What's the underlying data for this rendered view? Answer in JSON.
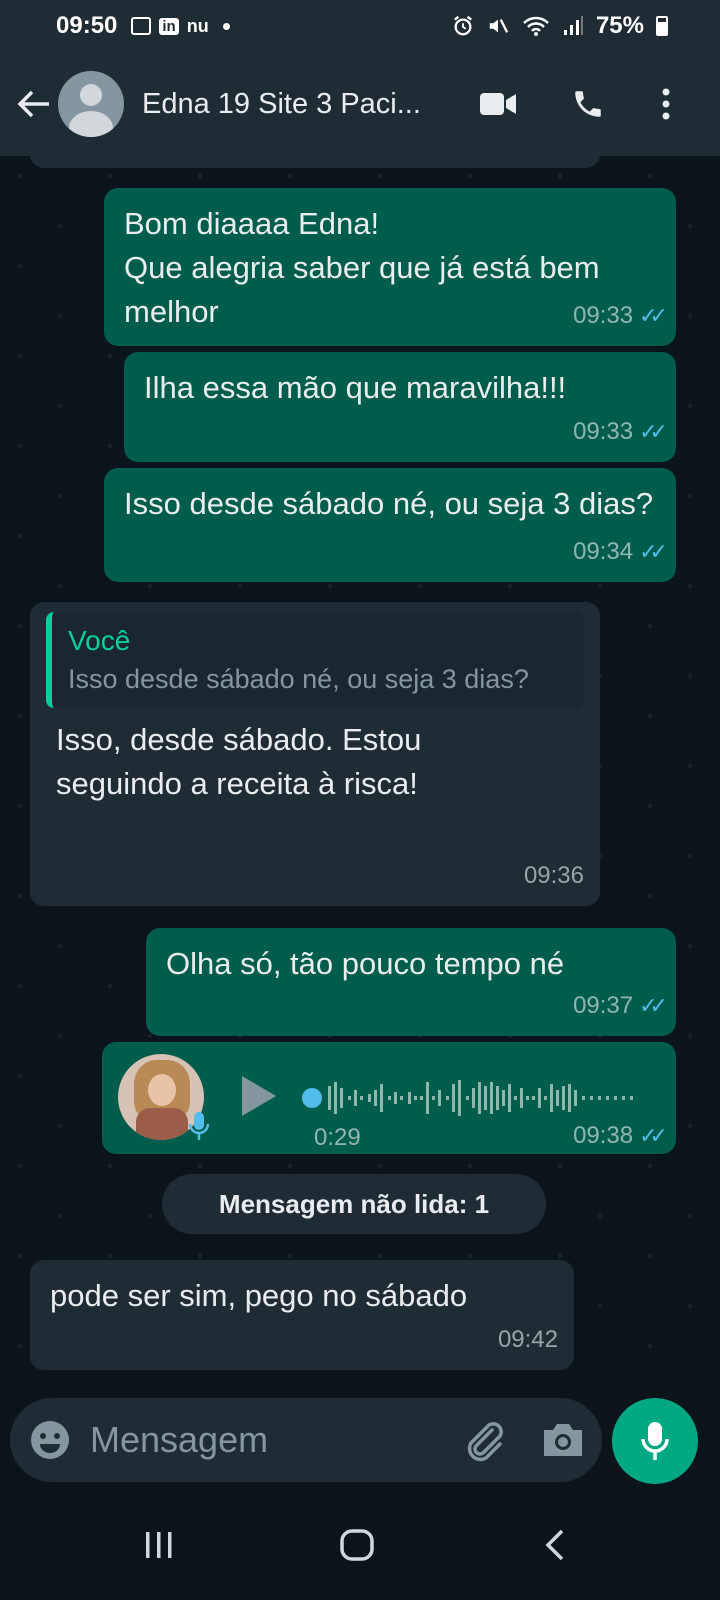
{
  "status_bar": {
    "time": "09:50",
    "left_icons": [
      "gallery-icon",
      "linkedin-icon",
      "nubank-icon",
      "notification-dot"
    ],
    "linkedin_text": "in",
    "nu_text": "nu",
    "right_icons": [
      "alarm-icon",
      "mute-icon",
      "wifi-icon",
      "signal-icon",
      "battery-icon"
    ],
    "battery": "75%"
  },
  "header": {
    "contact_name": "Edna 19 Site 3 Paci...",
    "icons": [
      "back-arrow-icon",
      "video-call-icon",
      "phone-icon",
      "more-options-icon"
    ]
  },
  "messages": [
    {
      "type": "out",
      "text": "Bom diaaaa Edna!\nQue alegria saber que já está bem melhor",
      "time": "09:33",
      "read": true
    },
    {
      "type": "out",
      "text": "Ilha essa mão que maravilha!!!",
      "time": "09:33",
      "read": true
    },
    {
      "type": "out",
      "text": "Isso desde sábado né,  ou seja 3 dias?",
      "time": "09:34",
      "read": true
    },
    {
      "type": "in",
      "quote_author": "Você",
      "quote_text": "Isso desde sábado né,  ou seja 3 dias?",
      "text": "Isso, desde sábado. Estou seguindo a receita à risca!",
      "time": "09:36"
    },
    {
      "type": "out",
      "text": "Olha só,  tão pouco tempo né",
      "time": "09:37",
      "read": true
    },
    {
      "type": "voice",
      "duration": "0:29",
      "time": "09:38",
      "read": true
    },
    {
      "type": "in",
      "text": "pode ser sim, pego no sábado",
      "time": "09:42"
    }
  ],
  "unread_label": "Mensagem não lida: 1",
  "composer": {
    "placeholder": "Mensagem",
    "icons": [
      "emoji-icon",
      "attach-icon",
      "camera-icon",
      "mic-icon"
    ]
  },
  "colors": {
    "outgoing_bubble": "#005c4b",
    "incoming_bubble": "#1f2c34",
    "background": "#0b141a",
    "accent": "#00a884",
    "read_ticks": "#53bdeb"
  }
}
